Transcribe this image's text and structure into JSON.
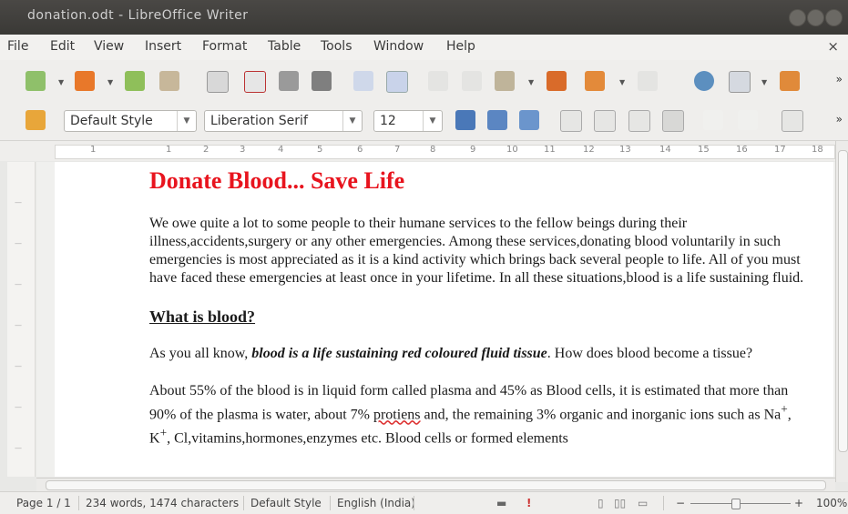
{
  "window": {
    "title": "donation.odt - LibreOffice Writer"
  },
  "menu": [
    "File",
    "Edit",
    "View",
    "Insert",
    "Format",
    "Table",
    "Tools",
    "Window",
    "Help"
  ],
  "menu_close": "×",
  "toolbar_more": "»",
  "formatting": {
    "style": "Default Style",
    "font": "Liberation Serif",
    "size": "12"
  },
  "ruler_numbers": [
    "1",
    "1",
    "2",
    "3",
    "4",
    "5",
    "6",
    "7",
    "8",
    "9",
    "10",
    "11",
    "12",
    "13",
    "14",
    "15",
    "16",
    "17",
    "18"
  ],
  "document": {
    "title": "Donate Blood... Save Life",
    "para1": "We owe quite a lot to some people to their humane services to the fellow beings during their illness,accidents,surgery or any other emergencies. Among these services,donating blood voluntarily in such emergencies is most appreciated as it is a kind activity which brings back several people to life. All of you must have faced these emergencies at least once in your lifetime. In all these situations,blood is a life sustaining fluid.",
    "heading": "What is  blood?",
    "para2_pre": "As you all know, ",
    "para2_em": "blood is a life sustaining red coloured fluid tissue",
    "para2_post": ". How does blood become a tissue?",
    "para3_a": "About 55% of the blood is in liquid form called plasma and 45% as Blood cells, it is estimated that more than 90% of the plasma is water, about 7% ",
    "para3_misspelled": "protiens",
    "para3_b": " and, the remaining 3% organic and inorganic ions such as Na",
    "para3_sup1": "+",
    "para3_c": ", K",
    "para3_sup2": "+",
    "para3_d": ", Cl,vitamins,hormones,enzymes etc. Blood cells or formed elements"
  },
  "status": {
    "page": "Page 1 / 1",
    "words": "234 words, 1474 characters",
    "style": "Default Style",
    "language": "English (India)",
    "zoom": "100%",
    "zoom_minus": "−",
    "zoom_plus": "+"
  }
}
